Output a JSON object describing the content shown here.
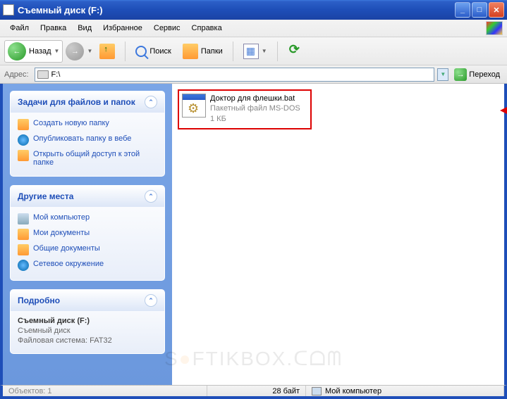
{
  "window": {
    "title": "Съемный диск (F:)"
  },
  "menu": {
    "file": "Файл",
    "edit": "Правка",
    "view": "Вид",
    "favorites": "Избранное",
    "tools": "Сервис",
    "help": "Справка"
  },
  "toolbar": {
    "back": "Назад",
    "search": "Поиск",
    "folders": "Папки"
  },
  "address": {
    "label": "Адрес:",
    "value": "F:\\",
    "go": "Переход"
  },
  "tasks_panel": {
    "title": "Задачи для файлов и папок",
    "items": [
      "Создать новую папку",
      "Опубликовать папку в вебе",
      "Открыть общий доступ к этой папке"
    ]
  },
  "places_panel": {
    "title": "Другие места",
    "items": [
      "Мой компьютер",
      "Мои документы",
      "Общие документы",
      "Сетевое окружение"
    ]
  },
  "details_panel": {
    "title": "Подробно",
    "name": "Съемный диск (F:)",
    "type": "Съемный диск",
    "fs": "Файловая система: FAT32"
  },
  "file": {
    "name": "Доктор для флешки.bat",
    "type": "Пакетный файл MS-DOS",
    "size": "1 КБ"
  },
  "status": {
    "objects": "Объектов: 1",
    "bytes": "28 байт",
    "location": "Мой компьютер"
  },
  "watermark": {
    "text1": "S",
    "text2": "FTIKBOX",
    "text3": ".ᑕᗝᗰ"
  }
}
